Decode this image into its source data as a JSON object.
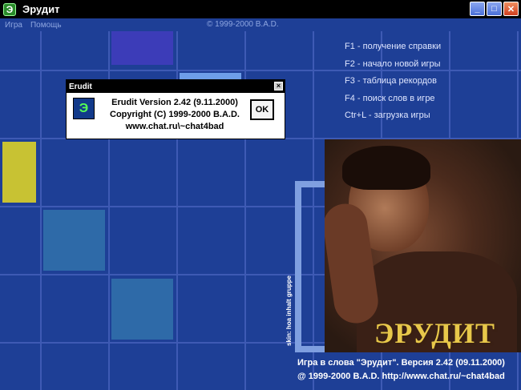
{
  "window": {
    "title": "Эрудит",
    "icon_glyph": "Э"
  },
  "menu": {
    "items": [
      {
        "label": "Игра"
      },
      {
        "label": "Помощь"
      }
    ],
    "copyright": "© 1999-2000 B.A.D."
  },
  "help": {
    "lines": [
      "F1 - получение справки",
      "F2 - начало новой игры",
      "F3 - таблица рекордов",
      "F4 - поиск слов в игре",
      "Ctr+L - загрузка игры"
    ]
  },
  "brand": {
    "logo": "ЭРУДИТ",
    "skin_credit": "skin: hoa inhalt gruppe"
  },
  "footer": {
    "line1": "Игра в слова \"Эрудит\". Версия 2.42 (09.11.2000)",
    "line2": "@ 1999-2000 B.A.D. http://www.chat.ru/~chat4bad"
  },
  "dialog": {
    "title": "Erudit",
    "lines": [
      "Erudit Version 2.42 (9.11.2000)",
      "Copyright (C) 1999-2000 B.A.D.",
      "www.chat.ru\\~chat4bad"
    ],
    "ok_label": "OK",
    "icon_glyph": "Э"
  },
  "colors": {
    "board": "#1e3f96",
    "grid": "#3e5ab4",
    "yellow": "#c8c233",
    "teal": "#2e6aa8",
    "violet": "#3c3cb8"
  }
}
